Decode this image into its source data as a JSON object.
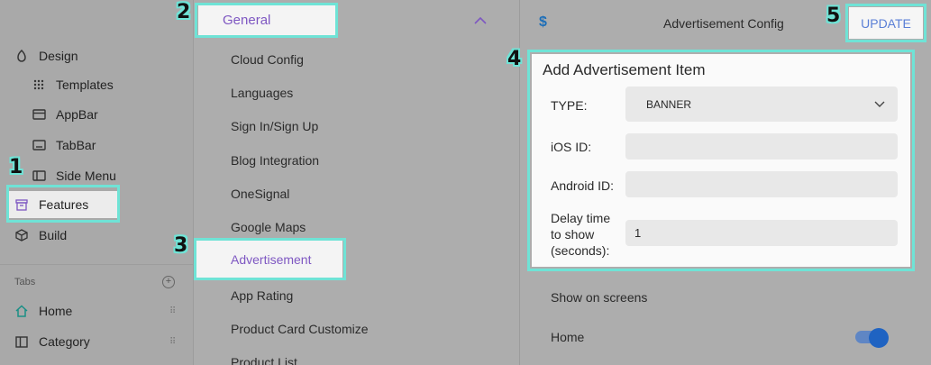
{
  "sidebar": {
    "items": [
      {
        "label": "Design",
        "icon": "palette-icon"
      },
      {
        "label": "Templates",
        "icon": "grid-dots-icon"
      },
      {
        "label": "AppBar",
        "icon": "appbar-icon"
      },
      {
        "label": "TabBar",
        "icon": "tabbar-icon"
      },
      {
        "label": "Side Menu",
        "icon": "side-menu-icon"
      },
      {
        "label": "Features",
        "icon": "archive-icon"
      },
      {
        "label": "Build",
        "icon": "cube-icon"
      }
    ],
    "tabs_header": "Tabs",
    "tabs": [
      {
        "label": "Home",
        "icon": "home-icon"
      },
      {
        "label": "Category",
        "icon": "category-icon"
      }
    ]
  },
  "features_menu": {
    "section_title": "General",
    "items": [
      "Cloud Config",
      "Languages",
      "Sign In/Sign Up",
      "Blog Integration",
      "OneSignal",
      "Google Maps",
      "Advertisement",
      "App Rating",
      "Product Card Customize",
      "Product List"
    ],
    "active_item": "Advertisement"
  },
  "config": {
    "currency_symbol": "$",
    "title": "Advertisement Config",
    "update_label": "UPDATE"
  },
  "ad_item": {
    "title": "Add Advertisement Item",
    "type_label": "TYPE:",
    "type_value": "BANNER",
    "ios_label": "iOS ID:",
    "ios_value": "",
    "android_label": "Android ID:",
    "android_value": "",
    "delay_label_1": "Delay time",
    "delay_label_2": "to show",
    "delay_label_3": "(seconds):",
    "delay_value": "1"
  },
  "screens": {
    "header": "Show on screens",
    "items": [
      {
        "label": "Home",
        "enabled": true
      }
    ]
  },
  "annotations": [
    "1",
    "2",
    "3",
    "4",
    "5"
  ],
  "colors": {
    "accent_purple": "#7e57c2",
    "highlight_cyan": "#6fe3d6",
    "toggle_blue": "#1f63c2",
    "update_blue": "#5a7fd6"
  }
}
